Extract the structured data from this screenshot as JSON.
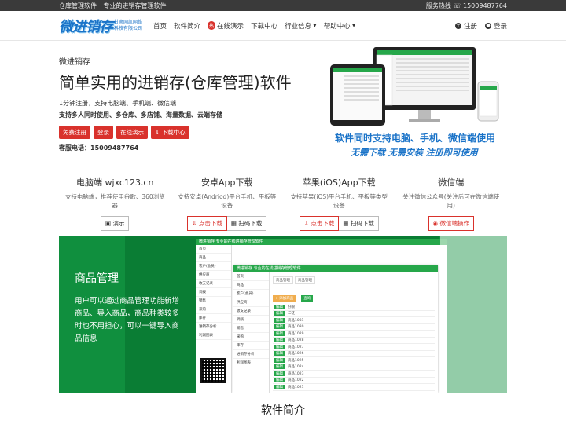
{
  "topbar": {
    "left": [
      "仓库管理软件",
      "专业的进销存管理软件"
    ],
    "right": "服务热线",
    "phone_icon": "phone-icon",
    "phone": "15009487764"
  },
  "nav": {
    "logo_main": "微进销存",
    "logo_sub": "甘肃网凯网络科技有限公司",
    "items": [
      "首页",
      "软件简介",
      "在线演示",
      "下载中心",
      "行业信息",
      "帮助中心"
    ],
    "hot_badge": "热",
    "register": "注册",
    "login": "登录"
  },
  "hero": {
    "brand": "微进销存",
    "title": "简单实用的进销存(仓库管理)软件",
    "sub1": "1分钟注册，支持电脑端、手机端、微信端",
    "sub2": "支持多人同时使用、多仓库、多店铺、海量数据、云端存储",
    "buttons": [
      "免费注册",
      "登录",
      "在线演示",
      "下载中心"
    ],
    "phone": "客服电话：15009487764",
    "slogan1": "软件同时支持电脑、手机、微信端使用",
    "slogan2": "无需下载  无需安装  注册即可使用"
  },
  "features": [
    {
      "title": "电脑端 wjxc123.cn",
      "desc": "支持电脑端，推荐使用谷歌、360浏览器",
      "buttons": [
        "演示"
      ]
    },
    {
      "title": "安卓App下载",
      "desc": "支持安卓(Andriod)平台手机、平板等设备",
      "buttons": [
        "点击下载",
        "扫码下载"
      ]
    },
    {
      "title": "苹果(iOS)App下载",
      "desc": "支持苹果(iOS)平台手机、平板等类型设备",
      "buttons": [
        "点击下载",
        "扫码下载"
      ]
    },
    {
      "title": "微信端",
      "desc": "关注微信公众号(关注后可在微信端使用)",
      "buttons": [
        "微信端操作"
      ]
    }
  ],
  "showcase": {
    "title": "商品管理",
    "desc": "用户可以通过商品管理功能新增商品、导入商品，商品种类较多时也不用担心，可以一键导入商品信息",
    "app_bar": "微进销存  专业的在线进销存管理软件",
    "side": [
      "首页",
      "商品",
      "客户(会员)",
      "供应商",
      "收支记录",
      "调拨",
      "销售",
      "采购",
      "库存",
      "进销存分析",
      "利润图表",
      "管理员",
      "设置"
    ],
    "tabs": [
      "首页",
      "导入商品"
    ],
    "tabs2": [
      "商品管理",
      "商品管理"
    ],
    "add_btn": "+ 添加商品",
    "search_btn": "查询",
    "rows": [
      "好眼",
      "三链",
      "商品1031",
      "商品1030",
      "商品1029",
      "商品1028",
      "商品1027",
      "商品1026",
      "商品1025",
      "商品1024",
      "商品1023",
      "商品1022",
      "商品1021"
    ],
    "edit": "编辑"
  },
  "intro_title": "软件简介"
}
